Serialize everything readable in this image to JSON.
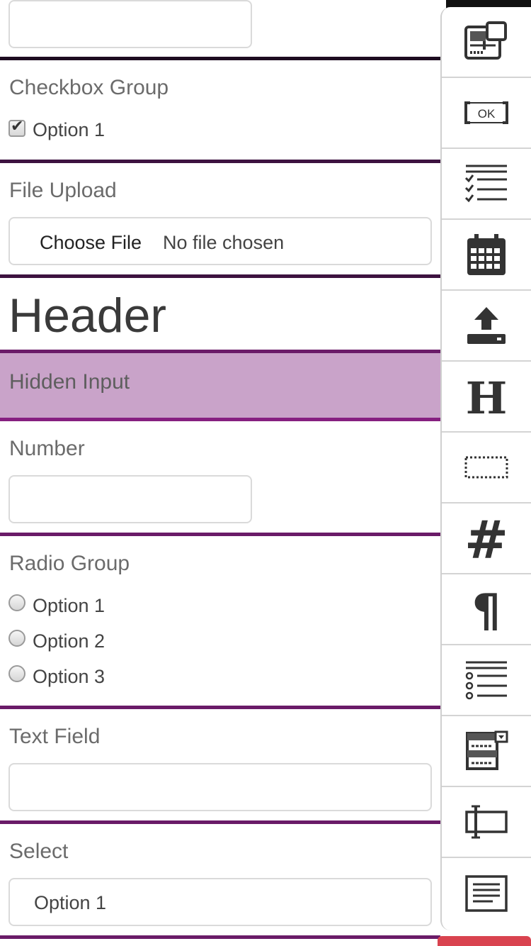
{
  "fields": {
    "checkbox_group": {
      "label": "Checkbox Group",
      "options": [
        "Option 1"
      ]
    },
    "file_upload": {
      "label": "File Upload",
      "button": "Choose File",
      "status": "No file chosen"
    },
    "header": {
      "text": "Header"
    },
    "hidden_input": {
      "label": "Hidden Input"
    },
    "number": {
      "label": "Number"
    },
    "radio_group": {
      "label": "Radio Group",
      "options": [
        "Option 1",
        "Option 2",
        "Option 3"
      ]
    },
    "text_field": {
      "label": "Text Field"
    },
    "select": {
      "label": "Select",
      "value": "Option 1"
    }
  },
  "toolbar": {
    "ok_text": "OK",
    "items": [
      "autocomplete-icon",
      "button-icon",
      "checkbox-group-icon",
      "calendar-icon",
      "file-upload-icon",
      "header-icon",
      "hidden-input-icon",
      "number-icon",
      "paragraph-icon",
      "radio-group-icon",
      "select-icon",
      "text-field-icon",
      "textarea-icon"
    ]
  },
  "colors": {
    "hidden_bg": "#c9a3c9",
    "border_dark": "#1d0c20",
    "border_purple": "#6a1b68",
    "border_magenta": "#861f80",
    "bottom_tab": "#d9434f"
  }
}
